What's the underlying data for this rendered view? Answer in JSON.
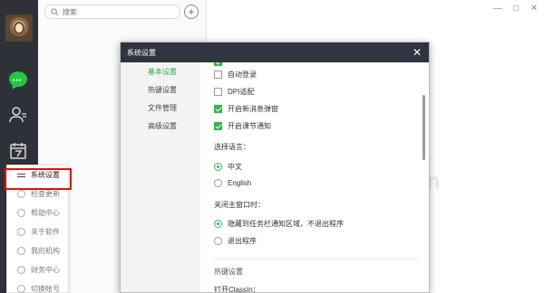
{
  "main": {
    "search_placeholder": "搜索",
    "add_symbol": "+",
    "window_controls": [
      "—",
      "□",
      "✕"
    ],
    "background_watermark": "n"
  },
  "menu": {
    "items": [
      {
        "label": "系统设置",
        "active": true
      },
      {
        "label": "检查更新"
      },
      {
        "label": "帮助中心"
      },
      {
        "label": "关于软件"
      },
      {
        "label": "我的机构"
      },
      {
        "label": "财务中心"
      },
      {
        "label": "切换帐号"
      }
    ]
  },
  "dialog": {
    "title": "系统设置",
    "close_symbol": "✕",
    "nav": [
      {
        "label": "基本设置",
        "active": true
      },
      {
        "label": "热键设置"
      },
      {
        "label": "文件管理"
      },
      {
        "label": "高级设置"
      }
    ],
    "options": [
      {
        "label": "自动登录",
        "checked": false
      },
      {
        "label": "DPI适配",
        "checked": false
      },
      {
        "label": "开启新消息弹窗",
        "checked": true
      },
      {
        "label": "开启课节通知",
        "checked": true
      }
    ],
    "language": {
      "label": "选择语言：",
      "choices": [
        {
          "label": "中文",
          "selected": true
        },
        {
          "label": "English",
          "selected": false
        }
      ]
    },
    "close_main": {
      "label": "关闭主窗口时：",
      "choices": [
        {
          "label": "隐藏到任务栏通知区域，不退出程序",
          "selected": true
        },
        {
          "label": "退出程序",
          "selected": false
        }
      ]
    },
    "hotkey": {
      "section_label": "热键设置",
      "open_label": "打开ClassIn："
    }
  },
  "colors": {
    "rail": "#2e3238",
    "accent_green": "#34b44c",
    "highlight_red": "#e01010",
    "dialog_header": "#2f3540"
  }
}
